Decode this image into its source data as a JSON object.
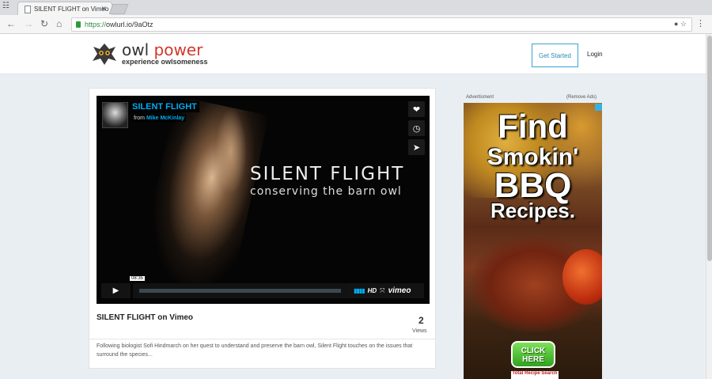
{
  "browser": {
    "tab_title": "SILENT FLIGHT on Vimeo",
    "url_scheme": "https://",
    "url_rest": "owlurl.io/9aOtz"
  },
  "site": {
    "logo_word1": "owl",
    "logo_word2": "power",
    "tagline": "experience owlsomeness",
    "get_started": "Get Started",
    "login": "Login"
  },
  "video": {
    "title": "SILENT FLIGHT",
    "from_prefix": "from",
    "author": "Mike McKinlay",
    "overlay_title": "SILENT FLIGHT",
    "overlay_subtitle": "conserving the barn owl",
    "timecode": "08:35",
    "hd": "HD",
    "vimeo": "vimeo",
    "icons": [
      "heart-icon",
      "clock-icon",
      "send-icon",
      "play-icon",
      "fullscreen-icon"
    ]
  },
  "card": {
    "title": "SILENT FLIGHT on Vimeo",
    "views_count": "2",
    "views_label": "Views",
    "description": "Following biologist Sofi Hindmarch on her quest to understand and preserve the barn owl, Silent Flight touches on the issues that surround the species..."
  },
  "ad": {
    "label": "Advertisment",
    "remove": "(Remove Ads)",
    "line1": "Find",
    "line2": "Smokin'",
    "line3": "BBQ",
    "line4": "Recipes.",
    "cta_line1": "CLICK",
    "cta_line2": "HERE",
    "brand": "Total Recipe Search"
  },
  "colors": {
    "accent": "#3aa4cf",
    "brand_red": "#d2372c",
    "vimeo_blue": "#00adef"
  }
}
